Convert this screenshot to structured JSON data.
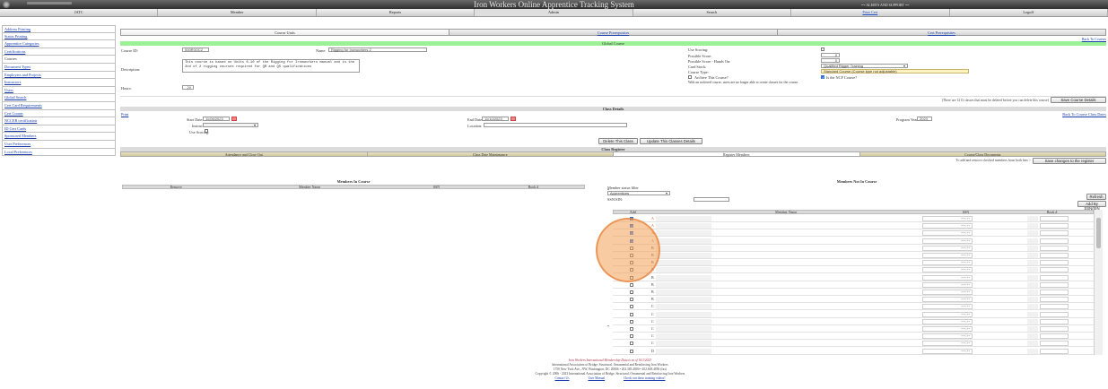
{
  "app": {
    "title": "Iron Workers Online Apprentice Tracking System",
    "alerts": "== ALERTS AND SUPPORT =="
  },
  "nav": [
    "JATC",
    "Member",
    "Reports",
    "Admin",
    "Search",
    "Print Cert",
    "Logoff"
  ],
  "sidebar": [
    "Address Printing",
    "Status Printing",
    "Apprentice Categories",
    "Certifications",
    "Courses",
    "Document Types",
    "Employers and Projects",
    "Instructors",
    "Users",
    "Global Search",
    "Cert Card Requirements",
    "Cert Counts",
    "NCCER certification",
    "ID Cert Cards",
    "Sponsored Members",
    "User Preferences",
    "Local Preferences"
  ],
  "tabs": [
    "Course Units",
    "Course Prerequisites",
    "Cert Prerequisites"
  ],
  "back_course": "Back To Courses",
  "global_course": "Global Course",
  "course": {
    "id_label": "Course ID:",
    "id_value": "000R0OC2",
    "name_label": "Name:",
    "name_value": "Rigging for Ironworkers 2",
    "desc_label": "Description:",
    "desc_value": "This course is based on Units 6-10 of the Rigging for Ironworkers manual and is the 2nd of 2 rigging courses required for QR and QS qualifications",
    "hours_label": "Hours:",
    "hours_value": "20",
    "scoring_label": "Use Scoring:",
    "possible_label": "Possible Score:",
    "possible_value": "0",
    "possible_hands_label": "Possible Score - Hands On:",
    "possible_hands_value": "0",
    "card_stock_label": "Card Stock:",
    "card_stock_value": "Qualified Rigger Training",
    "course_type_label": "Course Type:",
    "course_type_value": "Standard Course (Course type not adjustable)",
    "archive_label": "Archive This Course?",
    "archive_note": "With an archived course, users are no longer able to create classes for the course.",
    "ncf_label": "Is the NCF Course?",
    "delete_note": "(There are 1213 classes that must be deleted before you can delete this course)",
    "save_label": "Save Course Details"
  },
  "class_details": {
    "header": "Class Details",
    "print": "Print",
    "back": "Back To Course Class Dates",
    "start_label": "Start Date:",
    "start_value": "11/06/2023",
    "end_label": "End Date:",
    "end_value": "11/10/2023",
    "instructor_label": "Instructor:",
    "location_label": "Location:",
    "scoring_label": "Use Scoring:",
    "program_year_label": "Program Year:",
    "program_year_value": "2023",
    "delete_btn": "Delete This Class",
    "update_btn": "Update This Classes Details"
  },
  "register": {
    "header": "Class Register",
    "tabs": [
      "Attendance and Close Out",
      "Class Date Maintenance",
      "Register Members",
      "Course/Class Documents"
    ],
    "hint": "To add and remove checked members from both lists >",
    "save_btn": "Save changes to the register",
    "in_course": {
      "title": "Members In Course",
      "cols": [
        "Remove",
        "Member Name",
        "SSN",
        "Book #"
      ]
    },
    "not_in_course": {
      "title": "Members Not In Course",
      "filter_label": "Member status filter",
      "filter_value": "Apprentices",
      "ssn_label": "SSN/SIN:",
      "refresh_btn": "Refresh",
      "add_btn": "Add By SSN/SIN",
      "cols": [
        "Add",
        "Member Name",
        "SSN",
        "Book #"
      ],
      "rows": [
        {
          "checked": true,
          "initial": "A",
          "ssn": "***-**"
        },
        {
          "checked": true,
          "initial": "A",
          "ssn": "***-**"
        },
        {
          "checked": true,
          "initial": "A",
          "ssn": "***-**"
        },
        {
          "checked": true,
          "initial": "A",
          "ssn": "***-**"
        },
        {
          "checked": false,
          "initial": "B",
          "ssn": "***-**"
        },
        {
          "checked": false,
          "initial": "B",
          "ssn": "***-**"
        },
        {
          "checked": false,
          "initial": "B",
          "ssn": "***-**"
        },
        {
          "checked": false,
          "initial": "B",
          "ssn": "***-**"
        },
        {
          "checked": false,
          "initial": "B",
          "ssn": "***-**"
        },
        {
          "checked": false,
          "initial": "B",
          "ssn": "***-**"
        },
        {
          "checked": false,
          "initial": "B",
          "ssn": "***-**"
        },
        {
          "checked": false,
          "initial": "B",
          "ssn": "***-**"
        },
        {
          "checked": false,
          "initial": "C",
          "ssn": "***-**"
        },
        {
          "checked": false,
          "initial": "C",
          "ssn": "***-**"
        },
        {
          "checked": false,
          "initial": "C",
          "ssn": "***-**"
        },
        {
          "checked": false,
          "initial": "C",
          "ssn": "***-**"
        },
        {
          "checked": false,
          "initial": "C",
          "ssn": "***-**"
        },
        {
          "checked": false,
          "initial": "C",
          "ssn": "***-**"
        },
        {
          "checked": false,
          "initial": "D",
          "ssn": "***-**"
        }
      ]
    }
  },
  "footer": {
    "line1": "Iron Workers International Membership Data is as of 10/1/2023",
    "line2": "International Association of Bridge, Structural, Ornamental and Reinforcing Iron Workers",
    "line3": "1750 New York Ave., NW, Washington, DC 20006 • 202.383.4800 • 202.638.4856 (fax)",
    "line4": "Copyright © 2006 - 2023 International Association of Bridge, Structural, Ornamental and Reinforcing Iron Workers",
    "links": [
      "Contact Us",
      "User Manual",
      "Check out these training videos!"
    ]
  }
}
